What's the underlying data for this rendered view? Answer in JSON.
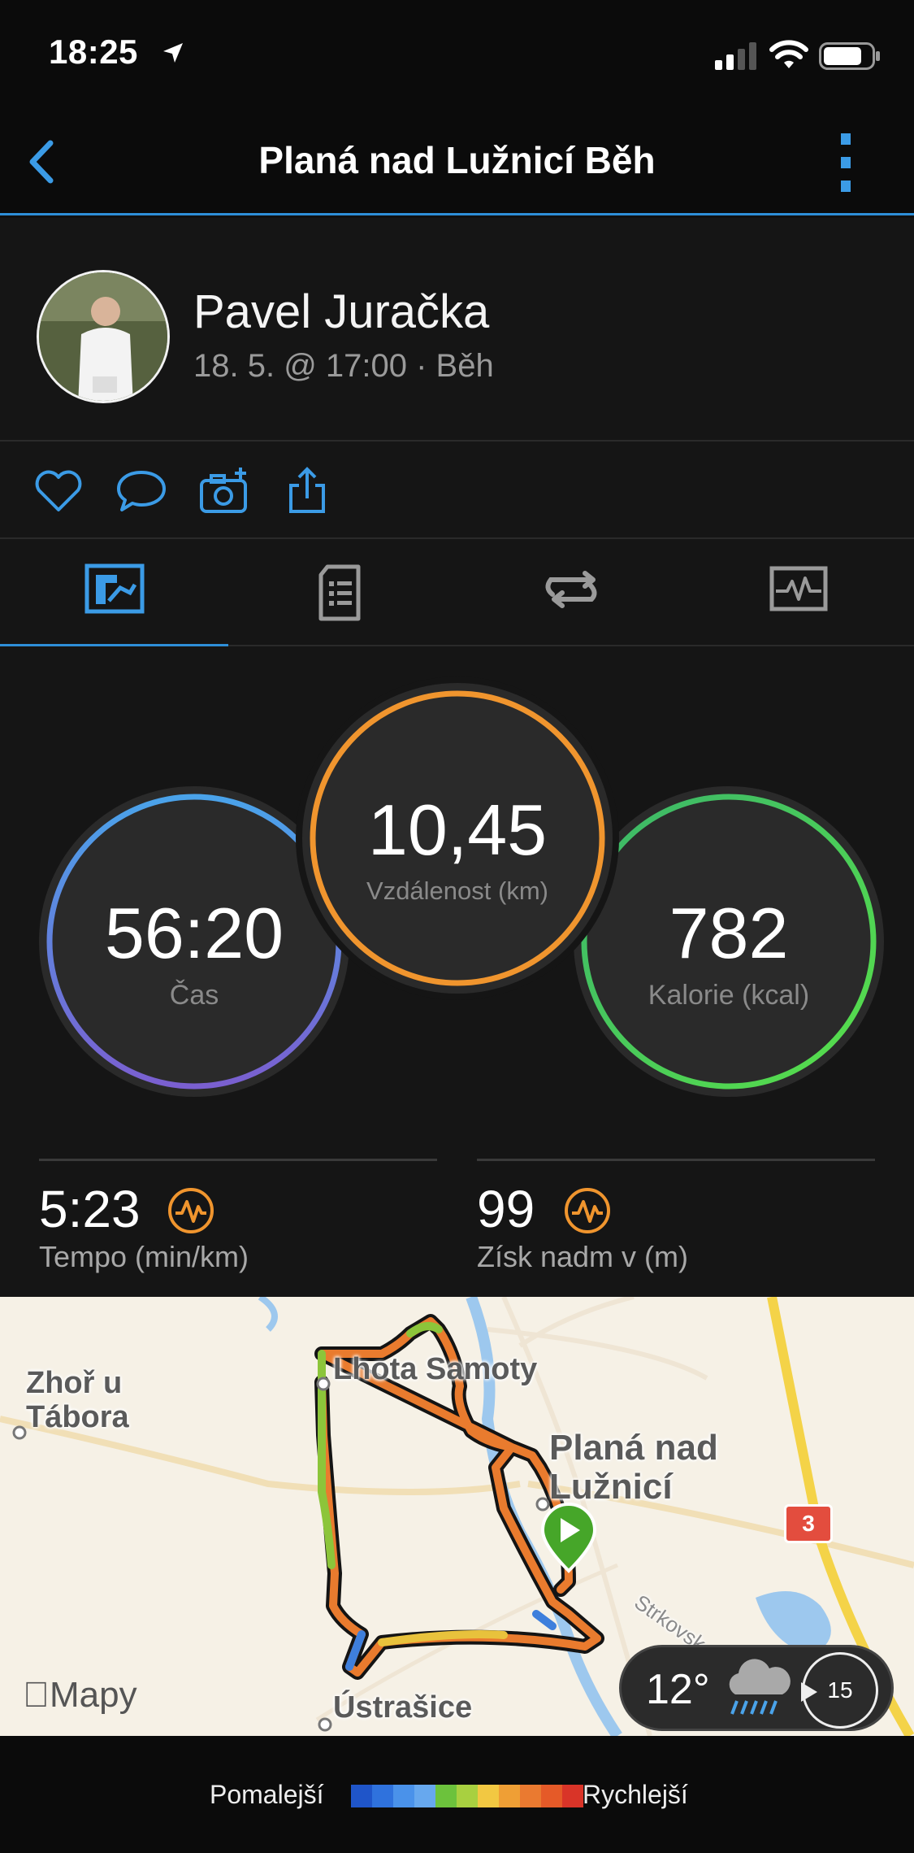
{
  "status": {
    "time": "18:25"
  },
  "nav": {
    "title": "Planá nad Lužnicí Běh"
  },
  "profile": {
    "name": "Pavel Juračka",
    "meta": "18. 5. @ 17:00 · Běh"
  },
  "actions": [
    "like-icon",
    "comment-icon",
    "add-photo-icon",
    "share-icon"
  ],
  "tabs": [
    {
      "icon": "overview-icon",
      "active": true
    },
    {
      "icon": "details-list-icon",
      "active": false
    },
    {
      "icon": "laps-icon",
      "active": false
    },
    {
      "icon": "charts-icon",
      "active": false
    }
  ],
  "stats": {
    "time": {
      "value": "56:20",
      "label": "Čas",
      "colors": [
        "#4aa3ea",
        "#7a5fd0"
      ]
    },
    "distance": {
      "value": "10,45",
      "label": "Vzdálenost (km)",
      "color": "#f0952e"
    },
    "calories": {
      "value": "782",
      "label": "Kalorie (kcal)",
      "colors": [
        "#3bb56a",
        "#58e04a"
      ]
    }
  },
  "metrics": [
    {
      "value": "5:23",
      "label": "Tempo (min/km)"
    },
    {
      "value": "99",
      "label": "Získ nadm v (m)"
    }
  ],
  "map": {
    "labels": {
      "zhor": "Zhoř u\nTábora",
      "lhota": "Lhota Samoty",
      "plana": "Planá nad\nLužnicí",
      "ustrasice": "Ústrašice",
      "street": "Strkovsk"
    },
    "road_number": "3",
    "maps_brand": "Mapy",
    "weather": {
      "temp": "12°",
      "wind_speed": "15"
    }
  },
  "legend": {
    "slow": "Pomalejší",
    "fast": "Rychlejší",
    "colors": [
      "#1f55c9",
      "#2f72dd",
      "#4a92ea",
      "#67a8ee",
      "#6cc23c",
      "#a8d040",
      "#f2c842",
      "#ef9f35",
      "#ea7a30",
      "#e55a28",
      "#d93428"
    ]
  },
  "colors": {
    "accent": "#2e8fd8",
    "background": "#151515"
  }
}
